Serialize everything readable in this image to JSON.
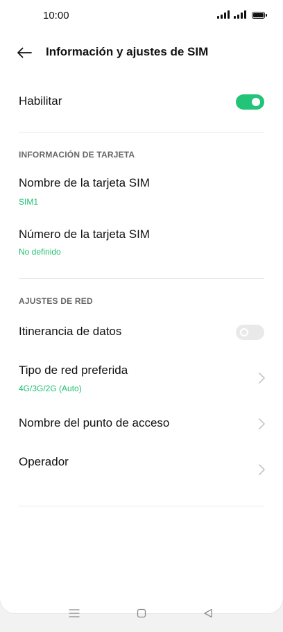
{
  "status_bar": {
    "time": "10:00",
    "icons": [
      "signal-icon",
      "signal-icon",
      "battery-icon"
    ]
  },
  "header": {
    "back_icon": "arrow-left-icon",
    "title": "Información y ajustes de SIM"
  },
  "enable": {
    "label": "Habilitar",
    "toggle_on": true
  },
  "card_info": {
    "section_title": "INFORMACIÓN DE TARJETA",
    "sim_name": {
      "label": "Nombre de la tarjeta SIM",
      "value": "SIM1"
    },
    "sim_number": {
      "label": "Número de la tarjeta SIM",
      "value": "No definido"
    }
  },
  "network": {
    "section_title": "AJUSTES DE RED",
    "roaming": {
      "label": "Itinerancia de datos",
      "toggle_on": false
    },
    "preferred_network": {
      "label": "Tipo de red preferida",
      "value": "4G/3G/2G (Auto)"
    },
    "apn": {
      "label": "Nombre del punto de acceso"
    },
    "operator": {
      "label": "Operador"
    }
  },
  "nav_bar": {
    "icons": [
      "menu-icon",
      "home-icon",
      "back-triangle-icon"
    ]
  },
  "colors": {
    "accent": "#22c477",
    "subtext": "#1fbf6e"
  }
}
